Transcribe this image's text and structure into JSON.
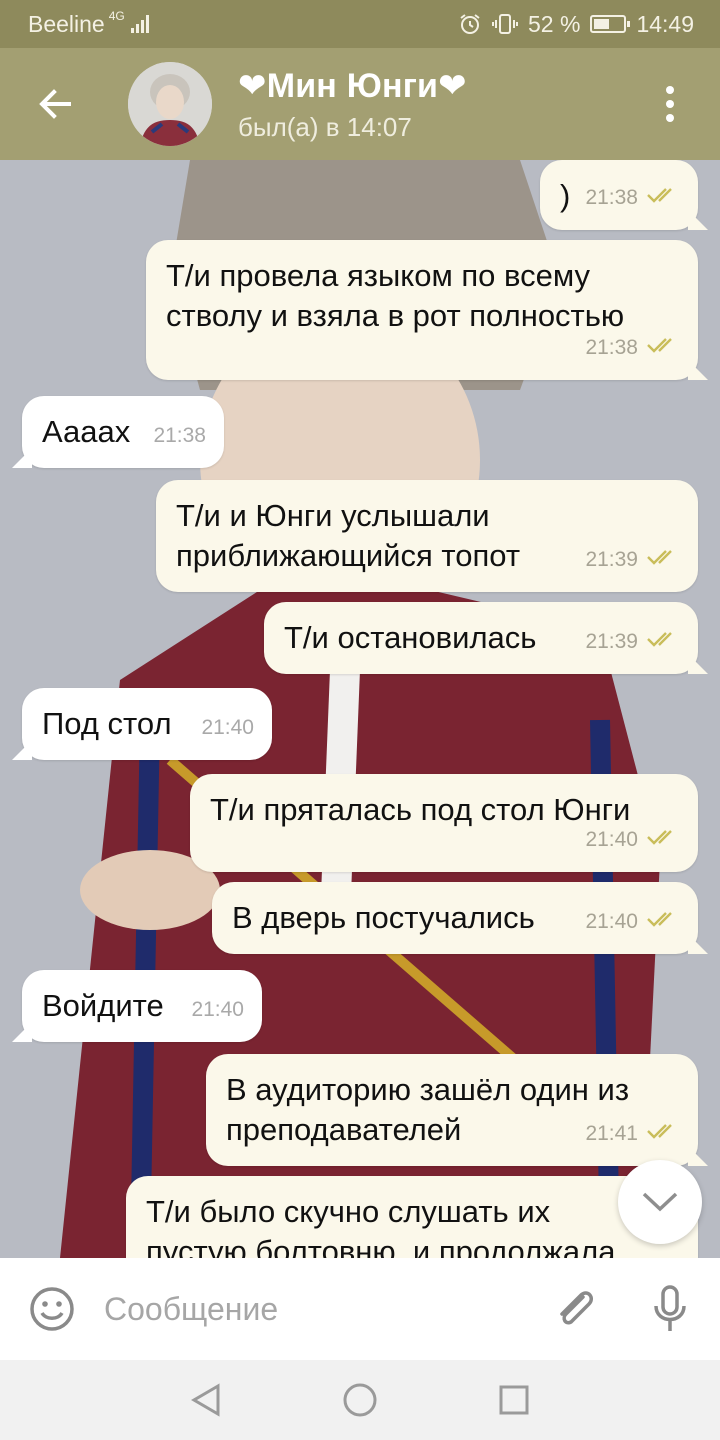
{
  "status_bar": {
    "carrier": "Beeline",
    "network": "4G",
    "battery": "52 %",
    "battery_level": 0.52,
    "time": "14:49"
  },
  "header": {
    "title": "❤Мин Юнги❤",
    "status": "был(а) в 14:07"
  },
  "messages": [
    {
      "dir": "out",
      "text": ")",
      "time": "21:38",
      "read": true
    },
    {
      "dir": "out",
      "text": "Т/и провела языком по всему\nстволу и взяла в рот полностью",
      "time": "21:38",
      "read": true
    },
    {
      "dir": "in",
      "text": "Ааааx",
      "time": "21:38"
    },
    {
      "dir": "out",
      "text": "Т/и и Юнги услышали\nприближающийся топот",
      "time": "21:39",
      "read": true
    },
    {
      "dir": "out",
      "text": "Т/и остановилась",
      "time": "21:39",
      "read": true
    },
    {
      "dir": "in",
      "text": "Под стол",
      "time": "21:40"
    },
    {
      "dir": "out",
      "text": "Т/и пряталась под стол Юнги",
      "time": "21:40",
      "read": true
    },
    {
      "dir": "out",
      "text": "В дверь постучались",
      "time": "21:40",
      "read": true
    },
    {
      "dir": "in",
      "text": "Войдите",
      "time": "21:40"
    },
    {
      "dir": "out",
      "text": "В аудиторию зашёл один из\nпреподавателей",
      "time": "21:41",
      "read": true
    },
    {
      "dir": "out",
      "text": "Т/и было скучно слушать их\nпустую болтовню, и продолжала",
      "time": "",
      "read": false
    }
  ],
  "input": {
    "placeholder": "Сообщение"
  },
  "icons": {
    "back": "arrow-left-icon",
    "menu": "more-vertical-icon",
    "emoji": "smiley-icon",
    "attach": "paperclip-icon",
    "mic": "microphone-icon",
    "scroll": "chevron-down-icon",
    "nav_back": "triangle-back-icon",
    "nav_home": "circle-home-icon",
    "nav_recent": "square-recent-icon"
  },
  "colors": {
    "header": "#a39f72",
    "status_bar": "#8e8a5c",
    "bubble_out": "#fbf8ea",
    "bubble_in": "#ffffff",
    "check": "#c9bd5a"
  }
}
